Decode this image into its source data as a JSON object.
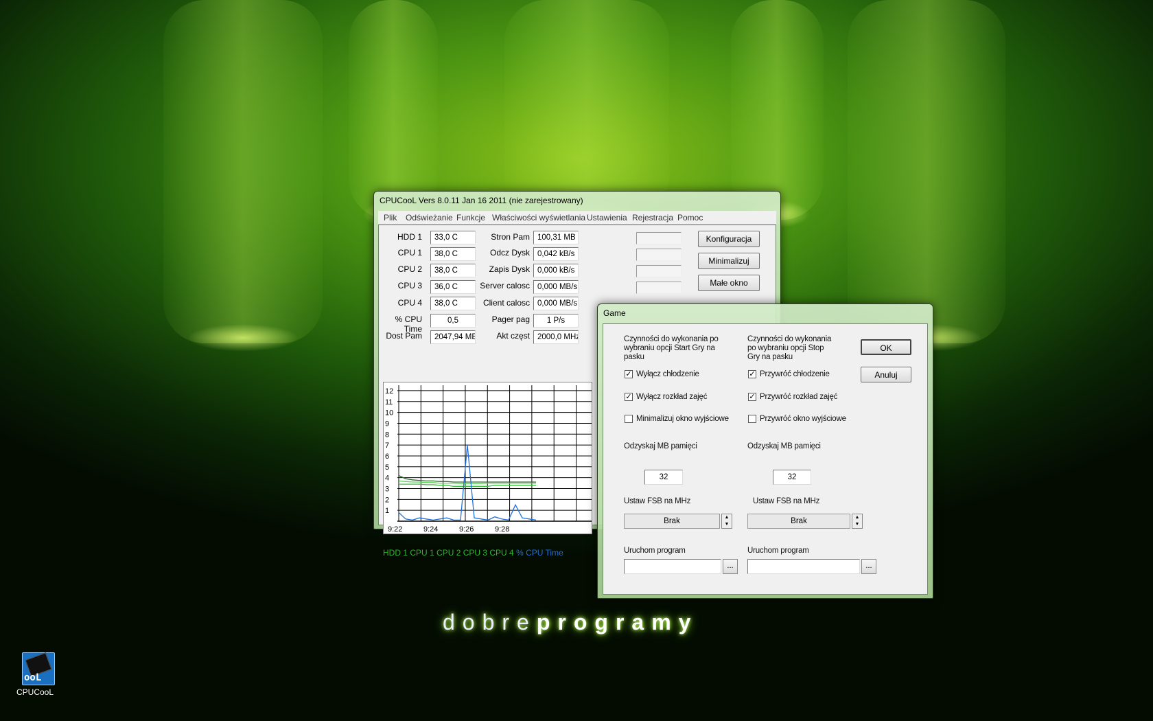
{
  "desktop": {
    "brand_part1": "dobre",
    "brand_part2": "programy",
    "icon_label": "CPUCooL",
    "icon_text": "ooL"
  },
  "main": {
    "title": "CPUCooL  Vers 8.0.11  Jan 16 2011 (nie zarejestrowany)",
    "menu": [
      "Plik",
      "Odświeżanie",
      "Funkcje",
      "Właściwości wyświetlania",
      "Ustawienia",
      "Rejestracja",
      "Pomoc"
    ],
    "left": [
      {
        "label": "HDD 1",
        "value": "33,0 C"
      },
      {
        "label": "CPU 1",
        "value": "38,0 C"
      },
      {
        "label": "CPU 2",
        "value": "38,0 C"
      },
      {
        "label": "CPU 3",
        "value": "36,0 C"
      },
      {
        "label": "CPU 4",
        "value": "38,0 C"
      },
      {
        "label": "% CPU Time",
        "value": "0,5"
      },
      {
        "label": "Dost Pam",
        "value": "2047,94 MB"
      }
    ],
    "middle": [
      {
        "label": "Stron Pam",
        "value": "100,31 MB"
      },
      {
        "label": "Odcz Dysk",
        "value": "0,042 kB/s"
      },
      {
        "label": "Zapis Dysk",
        "value": "0,000 kB/s"
      },
      {
        "label": "Server calosc",
        "value": "0,000 MB/s"
      },
      {
        "label": "Client calosc",
        "value": "0,000 MB/s"
      },
      {
        "label": "Pager pag",
        "value": "1 P/s"
      },
      {
        "label": "Akt częst",
        "value": "2000,0 MHz"
      }
    ],
    "buttons": [
      "Konfiguracja",
      "Minimalizuj",
      "Małe okno"
    ],
    "legend": {
      "green": "HDD 1 CPU 1 CPU 2 CPU 3 CPU 4",
      "blue": "% CPU Time",
      "green_color": "#2fb82f",
      "blue_color": "#1e6fe0"
    }
  },
  "chart_data": {
    "type": "line",
    "y_ticks": [
      "12",
      "11",
      "10",
      "9",
      "8",
      "7",
      "6",
      "5",
      "4",
      "3",
      "2",
      "1"
    ],
    "x_ticks": [
      "9:22",
      "9:24",
      "9:26",
      "9:28"
    ],
    "ylim": [
      0,
      12.5
    ],
    "grid": true,
    "series": [
      {
        "name": "HDD 1",
        "color": "#2a6a2a",
        "values": [
          4.2,
          3.9,
          3.8,
          3.75,
          3.7,
          3.7,
          3.65,
          3.65,
          3.6,
          3.6,
          3.6,
          3.6,
          3.6,
          3.6,
          3.6,
          3.6,
          3.6,
          3.6,
          3.6,
          3.6,
          3.6
        ]
      },
      {
        "name": "CPU 1",
        "color": "#3fbf3f",
        "values": [
          3.4,
          3.4,
          3.4,
          3.4,
          3.35,
          3.35,
          3.3,
          3.3,
          3.2,
          3.2,
          3.2,
          3.2,
          3.2,
          3.2,
          3.3,
          3.3,
          3.3,
          3.3,
          3.3,
          3.3,
          3.3
        ]
      },
      {
        "name": "CPU 2",
        "color": "#5ad05a",
        "values": [
          3.7,
          3.65,
          3.6,
          3.6,
          3.55,
          3.55,
          3.5,
          3.5,
          3.5,
          3.45,
          3.45,
          3.45,
          3.45,
          3.5,
          3.5,
          3.5,
          3.5,
          3.5,
          3.5,
          3.5,
          3.5
        ]
      },
      {
        "name": "% CPU Time",
        "color": "#1e6fe0",
        "values": [
          0.8,
          0.2,
          0.1,
          0.3,
          0.2,
          0.1,
          0.2,
          0.3,
          0.1,
          0.1,
          7.0,
          0.3,
          0.2,
          0.1,
          0.4,
          0.2,
          0.1,
          1.5,
          0.3,
          0.2,
          0.1
        ]
      }
    ]
  },
  "game": {
    "title": "Game",
    "col1_heading": "Czynności do wykonania po wybraniu opcji Start Gry na pasku",
    "col2_heading": "Czynności do wykonania po wybraniu opcji Stop Gry na pasku",
    "col1_checks": [
      {
        "label": "Wyłącz chłodzenie",
        "checked": "✓"
      },
      {
        "label": "Wyłącz rozkład zajęć",
        "checked": "✓"
      },
      {
        "label": "Minimalizuj okno wyjściowe",
        "checked": ""
      }
    ],
    "col2_checks": [
      {
        "label": "Przywróć chłodzenie",
        "checked": "✓"
      },
      {
        "label": "Przywróć rozkład zajęć",
        "checked": "✓"
      },
      {
        "label": "Przywróć okno wyjściowe",
        "checked": ""
      }
    ],
    "mem_label": "Odzyskaj MB pamięci",
    "mem1": "32",
    "mem2": "32",
    "fsb_label": "Ustaw FSB na MHz",
    "fsb1": "Brak",
    "fsb2": "Brak",
    "run_label": "Uruchom program",
    "browse": "...",
    "ok": "OK",
    "cancel": "Anuluj"
  }
}
